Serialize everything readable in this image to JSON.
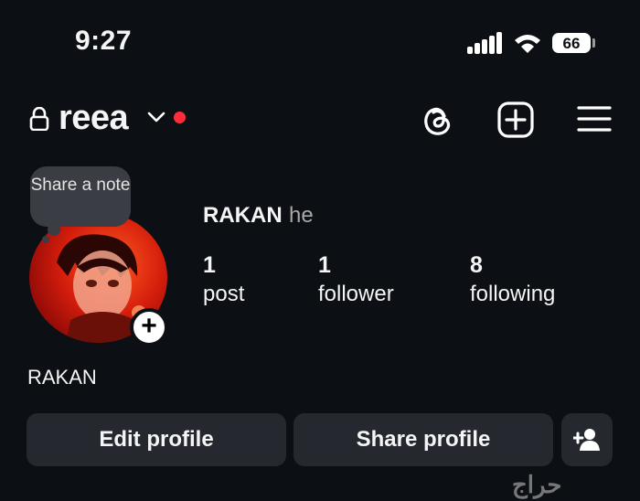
{
  "status_bar": {
    "time": "9:27",
    "battery": "66"
  },
  "header": {
    "username": "reea",
    "has_unread_dot": true
  },
  "icons": {
    "lock": "lock-icon",
    "chevron": "chevron-down-icon",
    "threads": "threads-icon",
    "create": "plus-square-icon",
    "menu": "hamburger-menu-icon",
    "add_friend": "add-person-icon"
  },
  "note_bubble": {
    "text": "Share a note"
  },
  "profile": {
    "full_name": "RAKAN",
    "pronouns": "he",
    "display_name": "RAKAN",
    "stats": [
      {
        "value": "1",
        "label": "post"
      },
      {
        "value": "1",
        "label": "follower"
      },
      {
        "value": "8",
        "label": "following"
      }
    ]
  },
  "buttons": {
    "edit": "Edit profile",
    "share": "Share profile"
  },
  "watermark": "حراج",
  "colors": {
    "background": "#0c0f14",
    "button": "#25292f",
    "dot": "#ff2d3b"
  }
}
